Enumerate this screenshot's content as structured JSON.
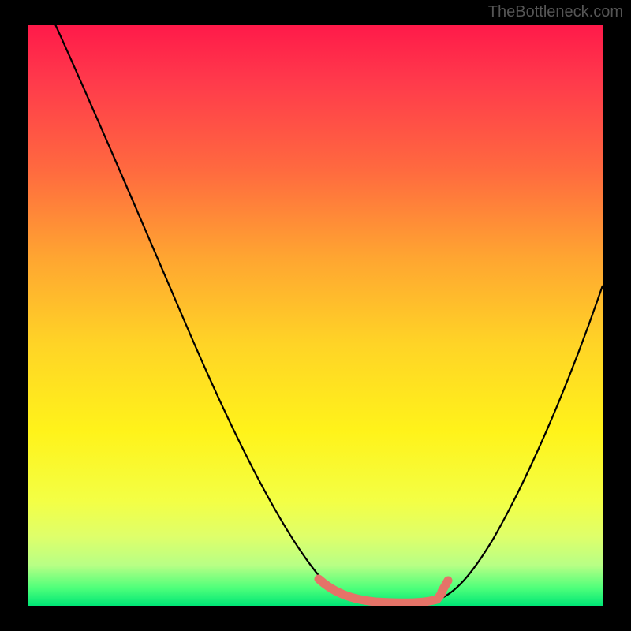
{
  "watermark": "TheBottleneck.com",
  "chart_data": {
    "type": "line",
    "title": "",
    "xlabel": "",
    "ylabel": "",
    "xlim": [
      0,
      100
    ],
    "ylim": [
      0,
      100
    ],
    "grid": false,
    "legend": false,
    "annotation": "Gradient background from red (top, high bottleneck) to green (bottom, no bottleneck). Black curve descends from top-left to a flat minimum near x≈55–70, then rises toward top-right. A thick salmon segment highlights the flat minimum region.",
    "series": [
      {
        "name": "bottleneck-curve",
        "x": [
          4,
          10,
          15,
          20,
          25,
          30,
          35,
          40,
          45,
          50,
          55,
          60,
          65,
          70,
          75,
          80,
          85,
          90,
          95,
          100
        ],
        "values": [
          100,
          88,
          78,
          68,
          58,
          48,
          38,
          28,
          18,
          10,
          4,
          1,
          0,
          0,
          2,
          8,
          18,
          30,
          44,
          58
        ]
      },
      {
        "name": "optimal-highlight",
        "x": [
          50,
          55,
          60,
          65,
          70,
          73
        ],
        "values": [
          4,
          1,
          0,
          0,
          1,
          3
        ]
      }
    ]
  }
}
